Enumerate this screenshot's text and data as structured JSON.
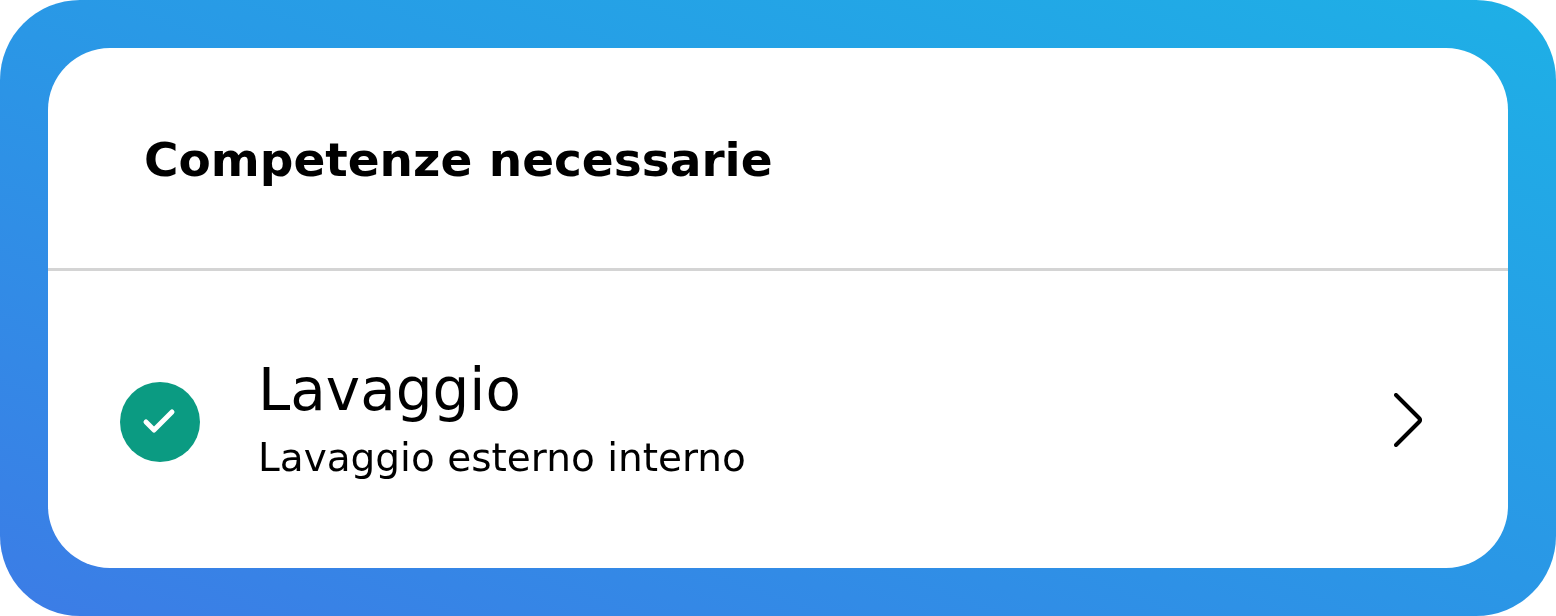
{
  "card": {
    "title": "Competenze necessarie"
  },
  "skills": [
    {
      "name": "Lavaggio",
      "description": "Lavaggio esterno interno",
      "completed": true
    }
  ]
}
